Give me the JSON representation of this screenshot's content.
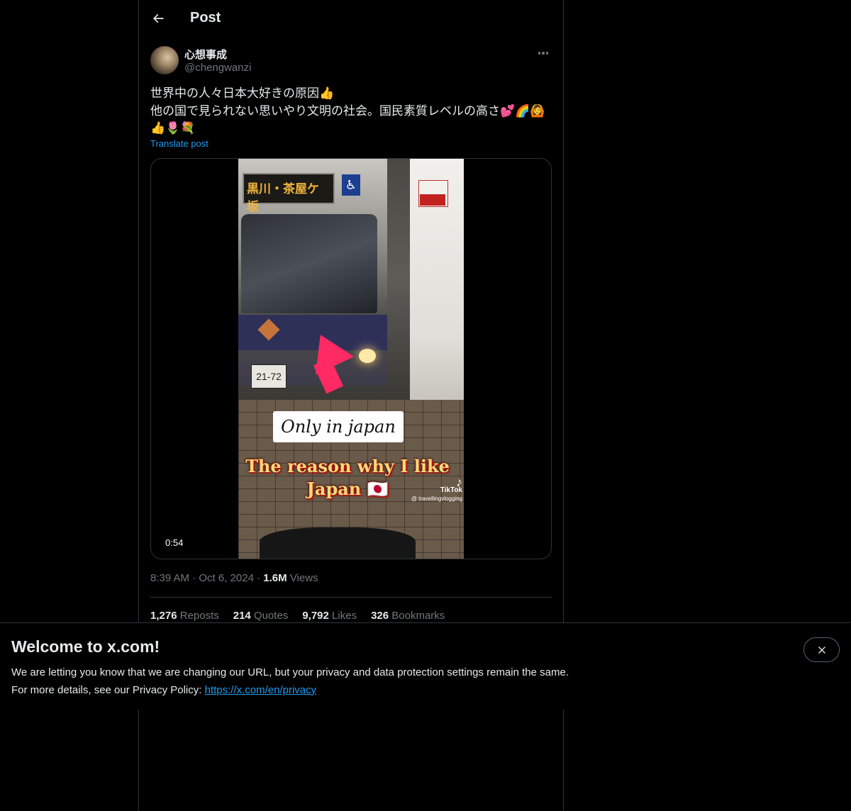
{
  "header": {
    "title": "Post"
  },
  "author": {
    "display_name": "心想事成",
    "handle": "@chengwanzi"
  },
  "post": {
    "text_line1": "世界中の人々日本大好きの原因👍",
    "text_line2": "他の国で見られない思いやり文明の社会。国民素質レベルの高さ💕🌈🙆",
    "text_line3": "👍🌷💐",
    "translate_label": "Translate post"
  },
  "video": {
    "duration": "0:54",
    "bus_sign_text": "黒川・茶屋ケ坂",
    "plate_text": "21-72",
    "caption_small": "Only in japan",
    "caption_big": "The reason why I like Japan 🇯🇵",
    "watermark_brand": "TikTok",
    "watermark_handle": "@ travellingvlogging"
  },
  "meta": {
    "time": "8:39 AM",
    "date": "Oct 6, 2024",
    "views_count": "1.6M",
    "views_label": "Views"
  },
  "stats": {
    "reposts_count": "1,276",
    "reposts_label": "Reposts",
    "quotes_count": "214",
    "quotes_label": "Quotes",
    "likes_count": "9,792",
    "likes_label": "Likes",
    "bookmarks_count": "326",
    "bookmarks_label": "Bookmarks"
  },
  "banner": {
    "title": "Welcome to x.com!",
    "line1": "We are letting you know that we are changing our URL, but your privacy and data protection settings remain the same.",
    "line2_prefix": "For more details, see our Privacy Policy: ",
    "link": "https://x.com/en/privacy"
  },
  "icons": {
    "back": "arrow-left-icon",
    "more": "more-icon",
    "close": "close-icon"
  },
  "colors": {
    "background": "#000000",
    "text_primary": "#e7e9ea",
    "text_secondary": "#71767b",
    "accent": "#1d9bf0",
    "border": "#2f3336"
  }
}
